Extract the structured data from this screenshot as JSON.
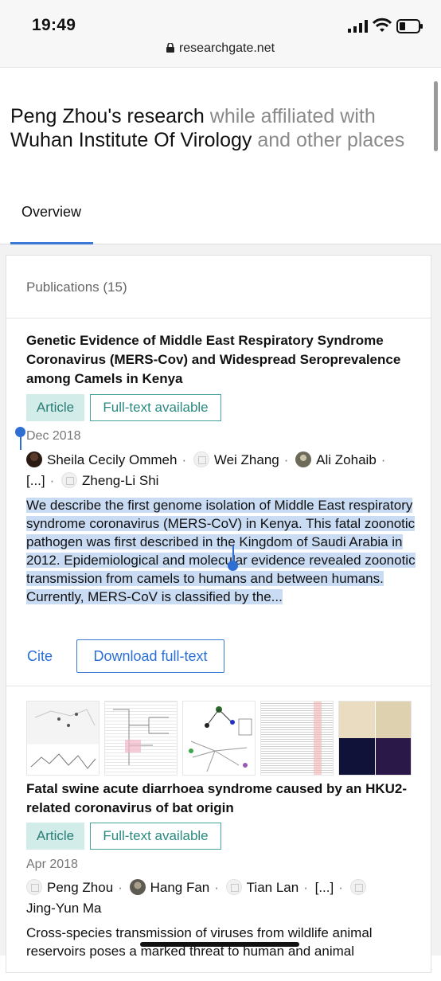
{
  "status": {
    "time": "19:49",
    "url": "researchgate.net"
  },
  "heading": {
    "name1": "Peng Zhou's research",
    "muted1": " while affiliated with",
    "name2": "Wuhan Institute Of Virology",
    "muted2": " and other places"
  },
  "tabs": [
    {
      "label": "Overview",
      "active": true
    }
  ],
  "publications": {
    "header": "Publications (15)",
    "items": [
      {
        "title": "Genetic Evidence of Middle East Respiratory Syndrome Coronavirus (MERS-Cov) and Widespread Seroprevalence among Camels in Kenya",
        "type": "Article",
        "availability": "Full-text available",
        "date": "Dec 2018",
        "authors": [
          "Sheila Cecily Ommeh",
          "Wei Zhang",
          "Ali Zohaib",
          "[...]",
          "Zheng-Li Shi"
        ],
        "abstract": "We describe the first genome isolation of Middle East respiratory syndrome coronavirus (MERS-CoV) in Kenya. This fatal zoonotic pathogen was first described in the Kingdom of Saudi Arabia in 2012. Epidemiological and molecular evidence revealed zoonotic transmission from camels to humans and between humans. Currently, MERS-CoV is classified by the...",
        "cite_label": "Cite",
        "download_label": "Download full-text"
      },
      {
        "title": "Fatal swine acute diarrhoea syndrome caused by an HKU2-related coronavirus of bat origin",
        "type": "Article",
        "availability": "Full-text available",
        "date": "Apr 2018",
        "authors": [
          "Peng Zhou",
          "Hang Fan",
          "Tian Lan",
          "[...]",
          "Jing-Yun Ma"
        ],
        "abstract": "Cross-species transmission of viruses from wildlife animal reservoirs poses a marked threat to human and animal"
      }
    ]
  },
  "colors": {
    "accent": "#3a78d6",
    "badge_teal": "#2a8a80",
    "selection": "#c9dcf3"
  }
}
